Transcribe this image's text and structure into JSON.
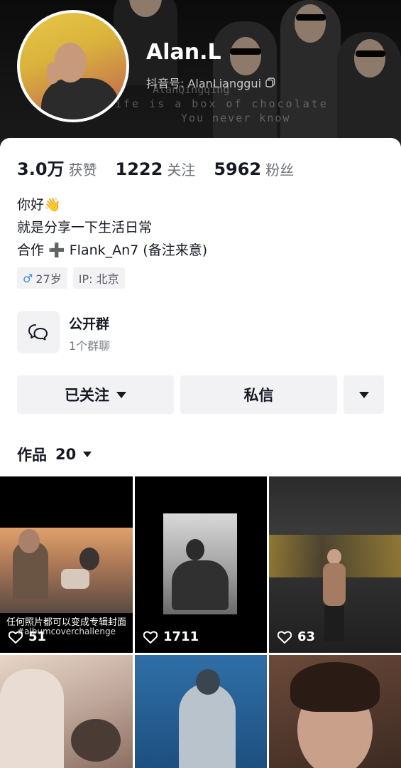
{
  "profile": {
    "name": "Alan.L",
    "douyin_id": "抖音号: AlanLianggui",
    "banner_text": {
      "line1": "AlanQingqing",
      "line2": "Life is a box of chocolate",
      "line3": "You never know"
    }
  },
  "stats": [
    {
      "value": "3.0万",
      "label": "获赞"
    },
    {
      "value": "1222",
      "label": "关注"
    },
    {
      "value": "5962",
      "label": "粉丝"
    }
  ],
  "bio": {
    "line1": "你好👋",
    "line2": "就是分享一下生活日常",
    "line3": "合作 ➕ Flank_An7 (备注来意)"
  },
  "tags": {
    "age": "27岁",
    "ip": "IP: 北京"
  },
  "group": {
    "title": "公开群",
    "subtitle": "1个群聊"
  },
  "actions": {
    "follow_label": "已关注",
    "message_label": "私信"
  },
  "works": {
    "label": "作品",
    "count": "20"
  },
  "tiles": [
    {
      "likes": "51",
      "caption": "任何照片都可以变成专辑封面",
      "hashtag": "#albumcoverchallenge"
    },
    {
      "likes": "1711"
    },
    {
      "likes": "63"
    },
    {},
    {},
    {}
  ],
  "colors": {
    "accent_male": "#3b8be8",
    "button_bg": "#f2f2f4",
    "text_primary": "#161823",
    "text_secondary": "#6f7177"
  }
}
